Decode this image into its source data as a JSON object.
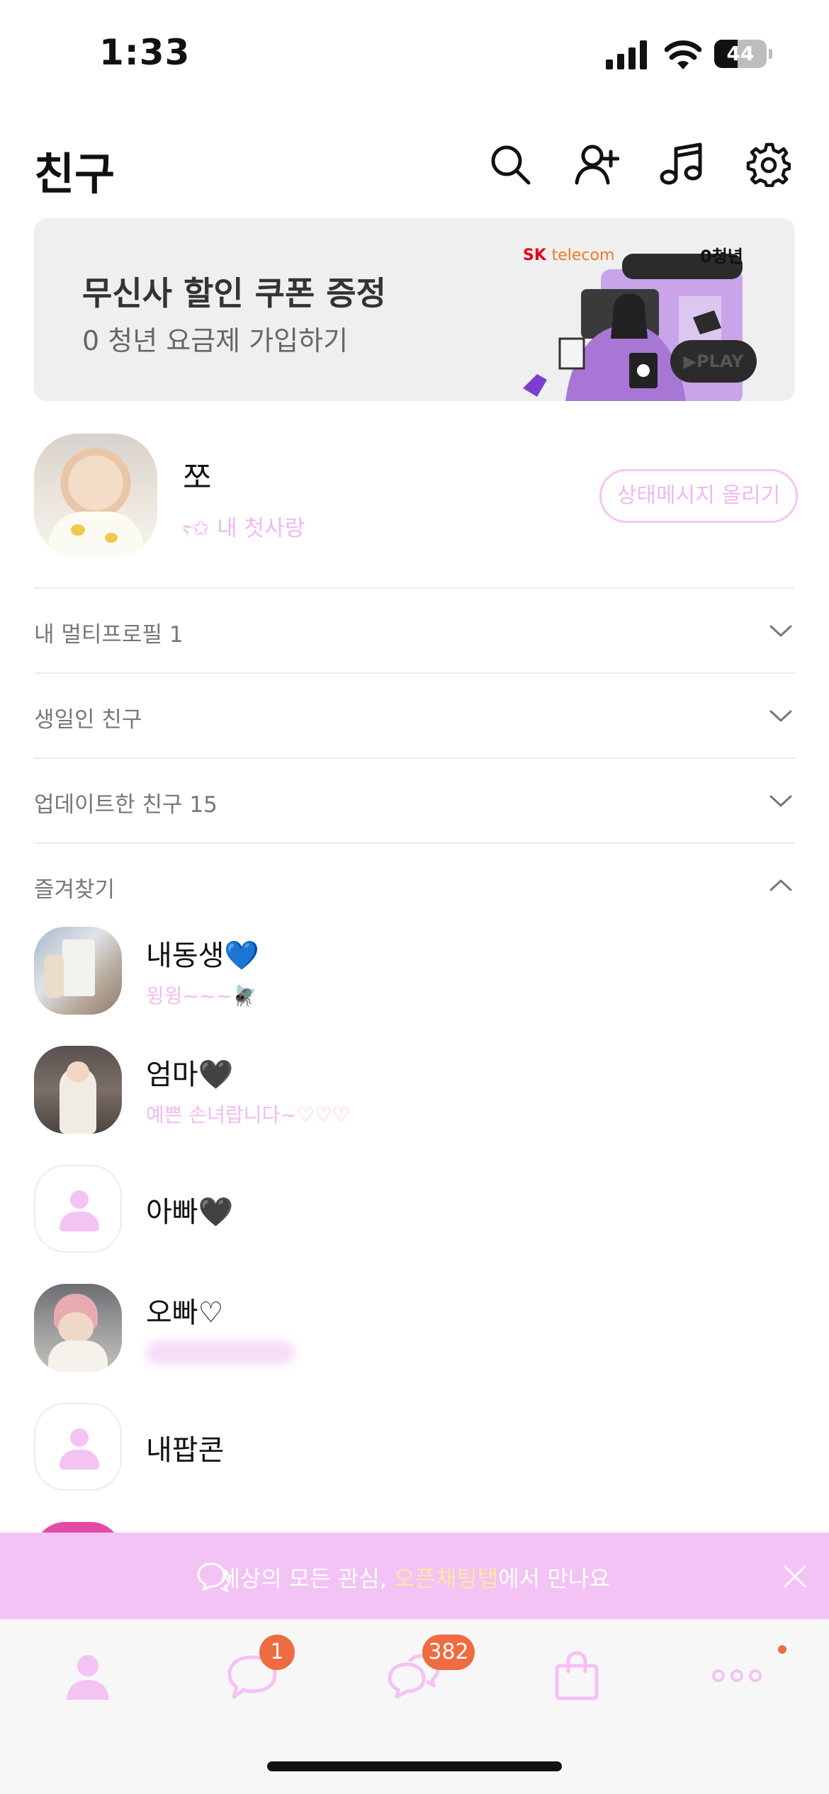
{
  "status_bar": {
    "time": "1:33",
    "battery": "44"
  },
  "header": {
    "title": "친구",
    "icons": [
      "search-icon",
      "add-friend-icon",
      "music-icon",
      "settings-icon"
    ]
  },
  "banner": {
    "title": "무신사 할인 쿠폰 증정",
    "subtitle": "0 청년 요금제 가입하기",
    "brand": "SK",
    "brand_suffix": "telecom",
    "zero_logo": "0청년",
    "play_label": "▶PLAY"
  },
  "profile": {
    "name": "쪼",
    "status": "ⲋ✩ 내 첫사랑",
    "status_button": "상태메시지 올리기"
  },
  "sections": [
    {
      "label": "내 멀티프로필 1",
      "expanded": false
    },
    {
      "label": "생일인 친구",
      "expanded": false
    },
    {
      "label": "업데이트한 친구 15",
      "expanded": false
    },
    {
      "label": "즐겨찾기",
      "expanded": true
    }
  ],
  "favorites": [
    {
      "name": "내동생💙",
      "status": "윙윙~~~🪰"
    },
    {
      "name": "엄마🖤",
      "status": "예쁜 손녀랍니다~♡♡♡"
    },
    {
      "name": "아빠🖤",
      "status": ""
    },
    {
      "name": "오빠♡",
      "status": ""
    },
    {
      "name": "내팝콘",
      "status": ""
    }
  ],
  "bottom_banner": {
    "text_before": "세상의 모든 관심, ",
    "highlight": "오픈채팅탭",
    "text_after": "에서 만나요"
  },
  "tab_bar": {
    "tabs": [
      "friends-tab",
      "chats-tab",
      "openchat-tab",
      "shopping-tab",
      "more-tab"
    ],
    "chats_badge": "1",
    "openchat_badge": "382"
  },
  "colors": {
    "accent_pink": "#f2c3f4",
    "badge": "#ee6c3f",
    "highlight_yellow": "#fde5a8"
  }
}
